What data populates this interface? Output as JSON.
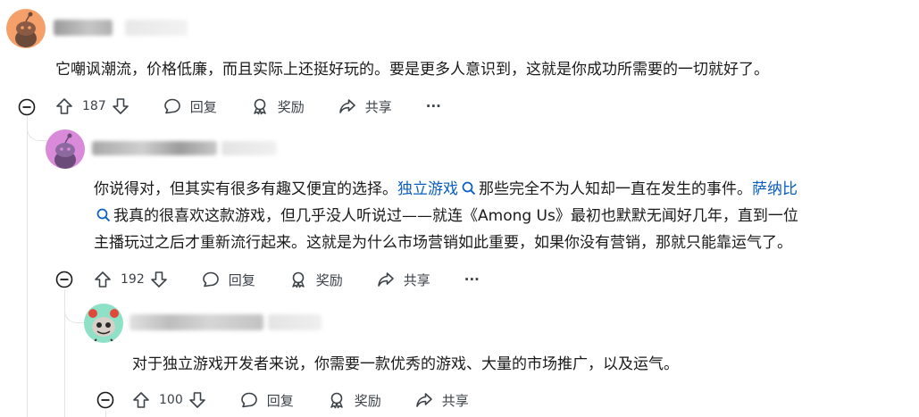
{
  "comments": [
    {
      "text": "它嘲讽潮流，价格低廉，而且实际上还挺好玩的。要是更多人意识到，这就是你成功所需要的一切就好了。",
      "votes": "187",
      "reply_label": "回复",
      "award_label": "奖励",
      "share_label": "共享",
      "more_label": "···"
    },
    {
      "text_part1": "你说得对，但其实有很多有趣又便宜的选择。",
      "link1": "独立游戏",
      "text_part2": "那些完全不为人知却一直在发生的事件。",
      "link2": "萨纳比",
      "line2": "我真的很喜欢这款游戏，但几乎没人听说过——就连《Among Us》最初也默默无闻好几年，直到一位",
      "line3": "主播玩过之后才重新流行起来。这就是为什么市场营销如此重要，如果你没有营销，那就只能靠运气了。",
      "votes": "192",
      "reply_label": "回复",
      "award_label": "奖励",
      "share_label": "共享",
      "more_label": "···"
    },
    {
      "text": "对于独立游戏开发者来说，你需要一款优秀的游戏、大量的市场推广，以及运气。",
      "votes": "100",
      "reply_label": "回复",
      "award_label": "奖励",
      "share_label": "共享"
    }
  ],
  "colors": {
    "link": "#0a5dc2",
    "avatar1": "#f5a06a",
    "avatar2": "#d98ad8",
    "avatar3": "#8ee0c6"
  }
}
